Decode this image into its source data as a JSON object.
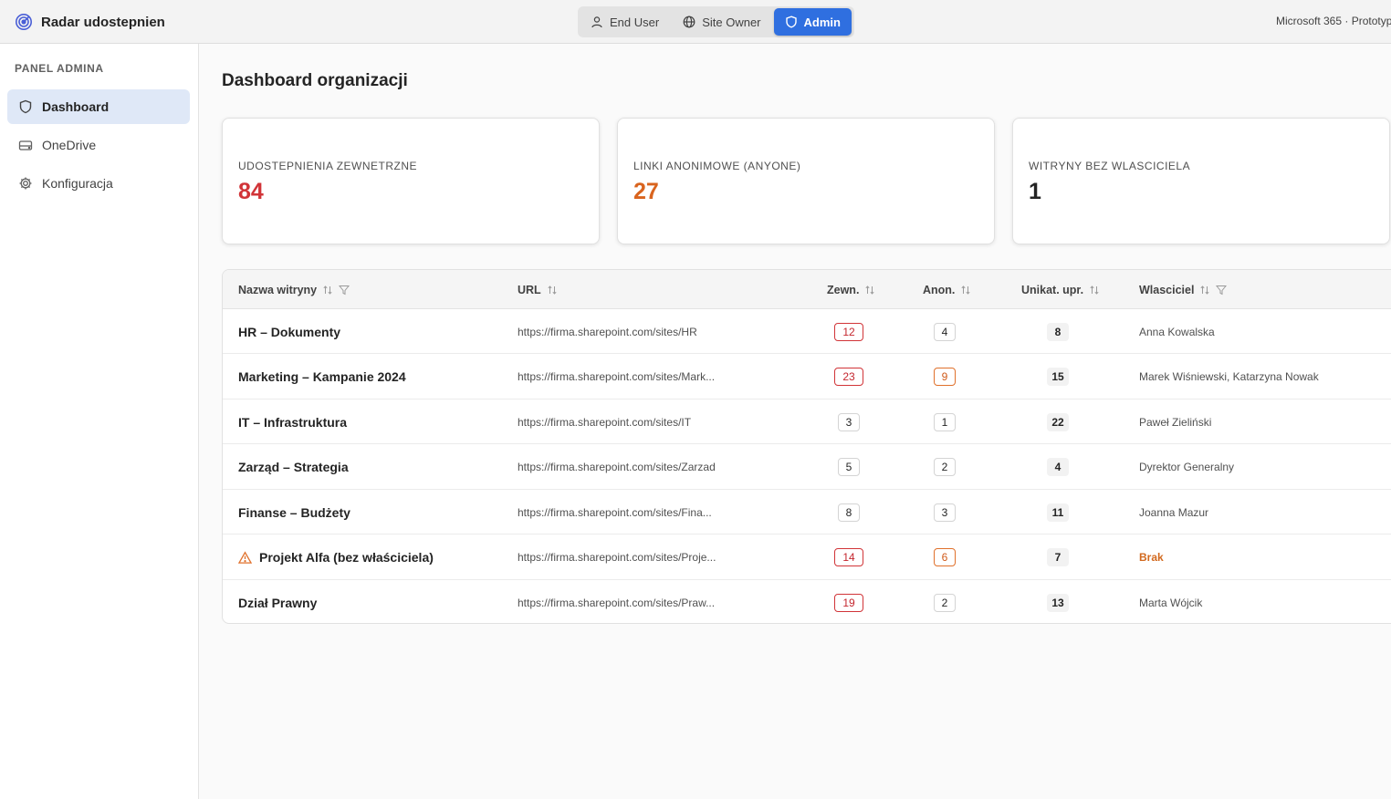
{
  "app": {
    "title": "Radar udostepnien",
    "environment": "Microsoft 365 · Prototyp"
  },
  "roles": [
    {
      "label": "End User",
      "icon": "person-icon",
      "active": false
    },
    {
      "label": "Site Owner",
      "icon": "globe-icon",
      "active": false
    },
    {
      "label": "Admin",
      "icon": "shield-icon",
      "active": true
    }
  ],
  "sidebar": {
    "title": "PANEL ADMINA",
    "items": [
      {
        "label": "Dashboard",
        "icon": "shield-icon",
        "active": true
      },
      {
        "label": "OneDrive",
        "icon": "drive-icon",
        "active": false
      },
      {
        "label": "Konfiguracja",
        "icon": "gear-icon",
        "active": false
      }
    ]
  },
  "main": {
    "title": "Dashboard organizacji",
    "stats": [
      {
        "label": "UDOSTEPNIENIA ZEWNETRZNE",
        "value": "84",
        "color": "#d13438"
      },
      {
        "label": "LINKI ANONIMOWE (ANYONE)",
        "value": "27",
        "color": "#d9641e"
      },
      {
        "label": "WITRYNY BEZ WLASCICIELA",
        "value": "1",
        "color": "#242424"
      }
    ],
    "table": {
      "columns": {
        "name": "Nazwa witryny",
        "url": "URL",
        "external": "Zewn.",
        "anon": "Anon.",
        "unique": "Unikat. upr.",
        "owner": "Wlasciciel"
      },
      "rows": [
        {
          "name": "HR – Dokumenty",
          "url": "https://firma.sharepoint.com/sites/HR",
          "external": "12",
          "external_style": "red",
          "anon": "4",
          "anon_style": "outline",
          "unique": "8",
          "owner": "Anna Kowalska",
          "warning": false
        },
        {
          "name": "Marketing – Kampanie 2024",
          "url": "https://firma.sharepoint.com/sites/Mark...",
          "external": "23",
          "external_style": "red",
          "anon": "9",
          "anon_style": "orange",
          "unique": "15",
          "owner": "Marek Wiśniewski, Katarzyna Nowak",
          "warning": false
        },
        {
          "name": "IT – Infrastruktura",
          "url": "https://firma.sharepoint.com/sites/IT",
          "external": "3",
          "external_style": "outline",
          "anon": "1",
          "anon_style": "outline",
          "unique": "22",
          "owner": "Paweł Zieliński",
          "warning": false
        },
        {
          "name": "Zarząd – Strategia",
          "url": "https://firma.sharepoint.com/sites/Zarzad",
          "external": "5",
          "external_style": "outline",
          "anon": "2",
          "anon_style": "outline",
          "unique": "4",
          "owner": "Dyrektor Generalny",
          "warning": false
        },
        {
          "name": "Finanse – Budżety",
          "url": "https://firma.sharepoint.com/sites/Fina...",
          "external": "8",
          "external_style": "outline",
          "anon": "3",
          "anon_style": "outline",
          "unique": "11",
          "owner": "Joanna Mazur",
          "warning": false
        },
        {
          "name": "Projekt Alfa (bez właściciela)",
          "url": "https://firma.sharepoint.com/sites/Proje...",
          "external": "14",
          "external_style": "red",
          "anon": "6",
          "anon_style": "orange",
          "unique": "7",
          "owner": "Brak",
          "warning": true
        },
        {
          "name": "Dział Prawny",
          "url": "https://firma.sharepoint.com/sites/Praw...",
          "external": "19",
          "external_style": "red",
          "anon": "2",
          "anon_style": "outline",
          "unique": "13",
          "owner": "Marta Wójcik",
          "warning": false
        }
      ]
    }
  }
}
